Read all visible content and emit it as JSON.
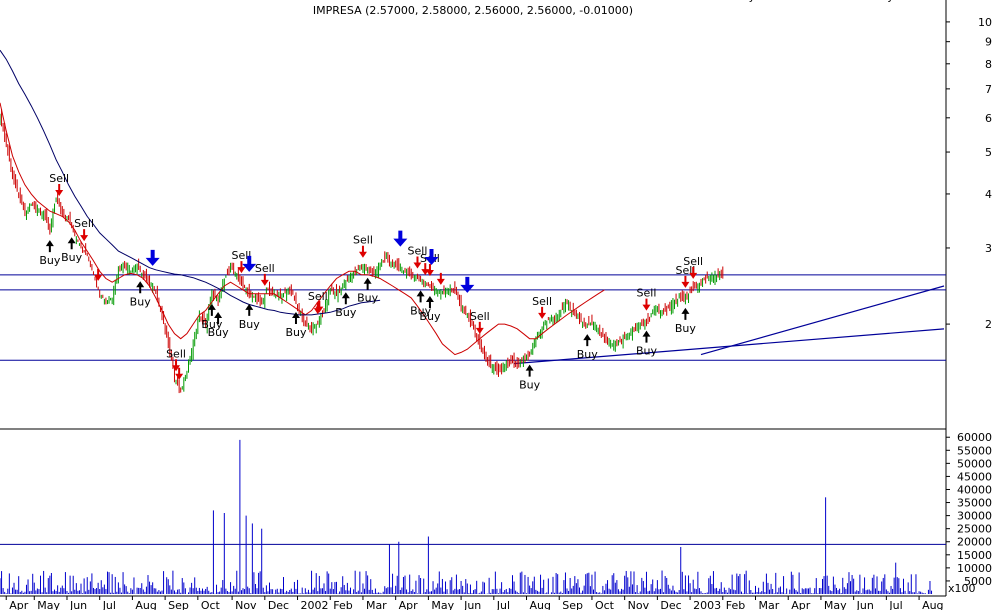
{
  "chart_data": {
    "type": "line",
    "title": "IMPRESA (2.57000, 2.58000, 2.56000, 2.56000, -0.01000)",
    "price_panel": {
      "y_scale": "log",
      "ylim": [
        1.15,
        11
      ],
      "y_ticks": [
        2,
        3,
        4,
        5,
        6,
        7,
        8,
        9,
        10
      ],
      "grid": false
    },
    "volume_panel": {
      "ylim": [
        0,
        62000
      ],
      "y_ticks": [
        5000,
        10000,
        15000,
        20000,
        25000,
        30000,
        35000,
        40000,
        45000,
        50000,
        55000,
        60000
      ],
      "multiplier_label": "x100",
      "reference_line": 19000
    },
    "x_tick_labels": [
      "Apr",
      "May",
      "Jun",
      "Jul",
      "Aug",
      "Sep",
      "Oct",
      "Nov",
      "Dec",
      "2002",
      "Feb",
      "Mar",
      "Apr",
      "May",
      "Jun",
      "Jul",
      "Aug",
      "Sep",
      "Oct",
      "Nov",
      "Dec",
      "2003",
      "Feb",
      "Mar",
      "Apr",
      "May",
      "Jun",
      "Jul",
      "Aug"
    ],
    "x_tick_index": [
      4,
      22,
      43,
      64,
      85,
      106,
      127,
      149,
      170,
      191,
      212,
      233,
      254,
      275,
      296,
      317,
      338,
      359,
      380,
      401,
      422,
      443,
      464,
      485,
      506,
      527,
      548,
      569,
      590
    ],
    "index_range": [
      0,
      606
    ],
    "price_series": {
      "t": [
        0,
        4,
        8,
        12,
        16,
        20,
        24,
        28,
        32,
        36,
        40,
        44,
        48,
        52,
        56,
        60,
        64,
        68,
        72,
        76,
        80,
        84,
        88,
        92,
        96,
        100,
        104,
        108,
        112,
        116,
        120,
        124,
        128,
        132,
        136,
        140,
        144,
        148,
        152,
        156,
        160,
        164,
        168,
        172,
        176,
        180,
        184,
        188,
        192,
        196,
        200,
        204,
        208,
        212,
        216,
        220,
        224,
        228,
        232,
        236,
        240,
        244,
        248,
        252,
        256,
        260,
        264,
        268,
        272,
        276,
        280,
        284,
        288,
        292,
        296,
        300,
        304,
        308,
        312,
        316,
        320,
        324,
        328,
        332,
        336,
        340,
        344,
        348,
        352,
        356,
        360,
        364,
        368,
        372,
        376,
        380,
        384,
        388,
        392,
        396,
        400,
        404,
        408,
        412,
        416,
        420,
        424,
        428,
        432,
        436,
        440,
        444,
        448,
        452,
        456,
        460,
        464,
        468,
        472,
        476,
        480,
        484,
        488,
        492,
        496,
        500,
        504,
        508,
        512,
        516,
        520,
        524,
        528,
        532,
        536,
        540,
        544,
        548,
        552,
        556,
        560,
        564,
        568,
        572,
        576,
        580,
        584,
        588,
        592,
        596,
        600,
        604
      ],
      "close": [
        6.1,
        5.2,
        4.4,
        3.95,
        3.6,
        3.8,
        3.7,
        3.6,
        3.3,
        3.9,
        3.6,
        3.5,
        3.2,
        3.0,
        2.9,
        2.6,
        2.35,
        2.25,
        2.3,
        2.7,
        2.75,
        2.65,
        2.7,
        2.6,
        2.5,
        2.35,
        2.1,
        1.8,
        1.5,
        1.4,
        1.55,
        1.8,
        2.1,
        2.0,
        2.35,
        2.25,
        2.55,
        2.7,
        2.6,
        2.45,
        2.35,
        2.3,
        2.25,
        2.4,
        2.35,
        2.3,
        2.4,
        2.35,
        2.15,
        2.0,
        1.95,
        2.0,
        2.15,
        2.4,
        2.35,
        2.45,
        2.55,
        2.65,
        2.7,
        2.7,
        2.6,
        2.75,
        2.85,
        2.75,
        2.7,
        2.65,
        2.6,
        2.55,
        2.5,
        2.45,
        2.4,
        2.35,
        2.4,
        2.4,
        2.2,
        2.1,
        1.95,
        1.8,
        1.65,
        1.6,
        1.55,
        1.6,
        1.65,
        1.6,
        1.65,
        1.7,
        1.85,
        1.95,
        2.05,
        2.05,
        2.15,
        2.25,
        2.1,
        2.05,
        2.0,
        2.0,
        1.95,
        1.85,
        1.8,
        1.8,
        1.85,
        1.9,
        1.95,
        2.0,
        2.05,
        2.15,
        2.15,
        2.15,
        2.25,
        2.3,
        2.3,
        2.4,
        2.45,
        2.55,
        2.55,
        2.6,
        2.6
      ],
      "ma_fast": [
        6.5,
        5.6,
        4.9,
        4.5,
        4.2,
        4.0,
        3.85,
        3.75,
        3.65,
        3.6,
        3.55,
        3.45,
        3.3,
        3.1,
        2.95,
        2.8,
        2.65,
        2.55,
        2.5,
        2.55,
        2.6,
        2.62,
        2.6,
        2.55,
        2.45,
        2.3,
        2.15,
        2.0,
        1.9,
        1.85,
        1.9,
        2.0,
        2.1,
        2.15,
        2.25,
        2.35,
        2.45,
        2.5,
        2.45,
        2.4,
        2.35,
        2.35,
        2.35,
        2.35,
        2.35,
        2.3,
        2.25,
        2.2,
        2.15,
        2.1,
        2.15,
        2.25,
        2.35,
        2.45,
        2.55,
        2.6,
        2.65,
        2.65,
        2.6,
        2.6,
        2.58,
        2.55,
        2.5,
        2.45,
        2.4,
        2.35,
        2.3,
        2.2,
        2.1,
        2.0,
        1.9,
        1.8,
        1.75,
        1.7,
        1.72,
        1.75,
        1.8,
        1.85,
        1.9,
        1.95,
        2.0,
        2.0,
        1.98,
        1.95,
        1.9,
        1.85,
        1.85,
        1.9,
        1.95,
        2.0,
        2.05,
        2.1,
        2.15,
        2.2,
        2.25,
        2.3,
        2.35,
        2.4
      ],
      "ma_slow": [
        8.6,
        8.2,
        7.7,
        7.2,
        6.8,
        6.4,
        6.0,
        5.6,
        5.2,
        4.8,
        4.5,
        4.2,
        3.95,
        3.75,
        3.55,
        3.4,
        3.25,
        3.15,
        3.05,
        2.95,
        2.9,
        2.85,
        2.8,
        2.75,
        2.7,
        2.67,
        2.65,
        2.63,
        2.61,
        2.6,
        2.58,
        2.56,
        2.53,
        2.5,
        2.46,
        2.42,
        2.38,
        2.33,
        2.29,
        2.25,
        2.22,
        2.2,
        2.18,
        2.16,
        2.15,
        2.13,
        2.12,
        2.11,
        2.1,
        2.1,
        2.1,
        2.11,
        2.12,
        2.13,
        2.15,
        2.17,
        2.2,
        2.22,
        2.24,
        2.25,
        2.26,
        2.27
      ]
    },
    "trend_lines": [
      {
        "name": "support-line-rising",
        "x": [
          330,
          606
        ],
        "y": [
          1.62,
          1.95
        ]
      },
      {
        "name": "short-uptrend-line",
        "x": [
          450,
          606
        ],
        "y": [
          1.7,
          2.45
        ]
      }
    ],
    "horizontal_levels": [
      2.6,
      2.4,
      1.65
    ],
    "buy_signals": [
      {
        "t": 32,
        "label": "Buy"
      },
      {
        "t": 46,
        "label": "Buy"
      },
      {
        "t": 90,
        "label": "Buy"
      },
      {
        "t": 136,
        "label": "Buy"
      },
      {
        "t": 140,
        "label": "Buy"
      },
      {
        "t": 160,
        "label": "Buy"
      },
      {
        "t": 190,
        "label": "Buy"
      },
      {
        "t": 222,
        "label": "Buy"
      },
      {
        "t": 236,
        "label": "Buy"
      },
      {
        "t": 270,
        "label": "Buy"
      },
      {
        "t": 276,
        "label": "Buy"
      },
      {
        "t": 340,
        "label": "Buy"
      },
      {
        "t": 377,
        "label": "Buy"
      },
      {
        "t": 415,
        "label": "Buy"
      },
      {
        "t": 440,
        "label": "Buy"
      },
      {
        "t": 478,
        "label": "Buy"
      },
      {
        "t": 567,
        "label": "Buy"
      }
    ],
    "sell_signals": [
      {
        "t": 38,
        "label": "Sell"
      },
      {
        "t": 54,
        "label": "Sell"
      },
      {
        "t": 113,
        "label": "Sell"
      },
      {
        "t": 155,
        "label": "Sell"
      },
      {
        "t": 170,
        "label": "Sell"
      },
      {
        "t": 204,
        "label": "Sell"
      },
      {
        "t": 233,
        "label": "Sell"
      },
      {
        "t": 268,
        "label": "Sell"
      },
      {
        "t": 276,
        "label": "Sell"
      },
      {
        "t": 308,
        "label": "Sell"
      },
      {
        "t": 348,
        "label": "Sell"
      },
      {
        "t": 415,
        "label": "Sell"
      },
      {
        "t": 440,
        "label": "Sell"
      },
      {
        "t": 445,
        "label": "Sell"
      },
      {
        "t": 565,
        "label": "Sell"
      }
    ],
    "sell_markers_plain": [
      63,
      115,
      205,
      273,
      283
    ],
    "arrow_markers": [
      98,
      160,
      257,
      277,
      300,
      585
    ],
    "volume_spikes": [
      {
        "t": 137,
        "value": 32000
      },
      {
        "t": 144,
        "value": 31000
      },
      {
        "t": 154,
        "value": 59000
      },
      {
        "t": 158,
        "value": 30000
      },
      {
        "t": 162,
        "value": 27000
      },
      {
        "t": 168,
        "value": 25000
      },
      {
        "t": 250,
        "value": 19000
      },
      {
        "t": 256,
        "value": 20000
      },
      {
        "t": 275,
        "value": 22000
      },
      {
        "t": 437,
        "value": 18000
      },
      {
        "t": 530,
        "value": 37000
      },
      {
        "t": 575,
        "value": 12000
      }
    ],
    "colors": {
      "candle_up": "#009900",
      "candle_down": "#cc0000",
      "ma_fast": "#cc0000",
      "ma_slow": "#000066",
      "lines": "#000099",
      "buy_arrow": "#000000",
      "sell_arrow": "#dd0000",
      "blue_arrow": "#0000dd",
      "volume": "#0000cc"
    }
  }
}
